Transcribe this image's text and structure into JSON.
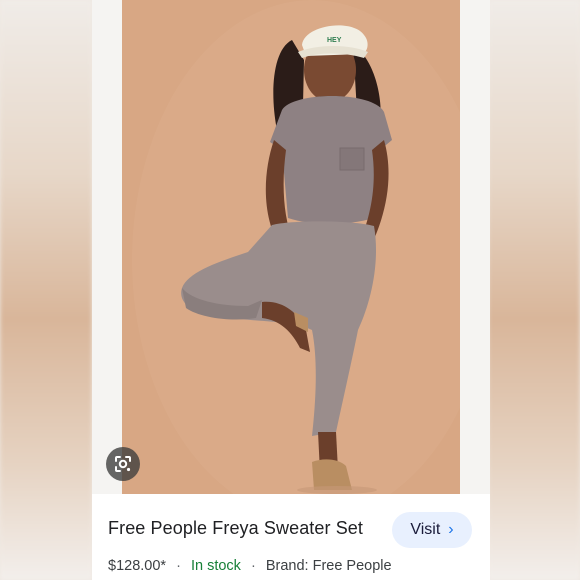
{
  "product": {
    "title": "Free People Freya Sweater Set",
    "price": "$128.00*",
    "stock": "In stock",
    "brand": "Brand: Free People",
    "separator": "·"
  },
  "actions": {
    "visit_label": "Visit",
    "visit_chevron": "›"
  },
  "icons": {
    "lens": "google-lens-icon"
  },
  "photo": {
    "hat_text": "HEY"
  },
  "colors": {
    "stock_green": "#188038",
    "visit_bg": "#e8f0fe",
    "accent_blue": "#1a73e8",
    "photo_backdrop": "#d8a886"
  }
}
